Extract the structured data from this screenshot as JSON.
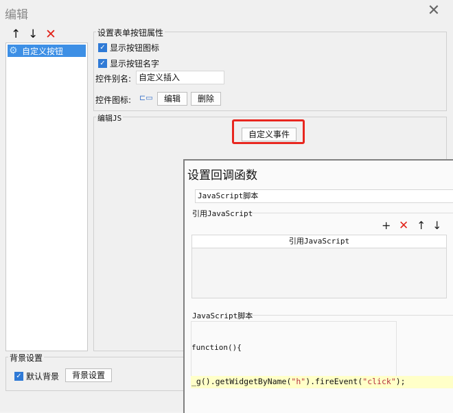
{
  "dialog": {
    "title": "编辑",
    "toolbar": [
      "↑",
      "↓",
      "✕"
    ],
    "tree": {
      "item": "自定义按钮"
    }
  },
  "props": {
    "legend": "设置表单按钮属性",
    "show_icon": "显示按钮图标",
    "show_name": "显示按钮名字",
    "alias_label": "控件别名:",
    "alias_value": "自定义插入",
    "icon_label": "控件图标:",
    "edit_btn": "编辑",
    "delete_btn": "删除"
  },
  "js": {
    "legend": "编辑JS",
    "custom_event_btn": "自定义事件"
  },
  "background": {
    "legend": "背景设置",
    "default_bg": "默认背景",
    "bg_btn": "背景设置"
  },
  "callback": {
    "title": "设置回调函数",
    "type_value": "JavaScript脚本",
    "ref_legend": "引用JavaScript",
    "ref_col_header": "引用JavaScript",
    "script_legend": "JavaScript脚本",
    "code_line1": "function(){",
    "code_line2_a": "_g().getWidgetByName(",
    "code_line2_b": "\"h\"",
    "code_line2_c": ").fireEvent(",
    "code_line2_d": "\"click\"",
    "code_line2_e": ");"
  },
  "colors": {
    "accent": "#3d8fe5",
    "highlight": "#e8261f",
    "string": "#b5303c"
  }
}
